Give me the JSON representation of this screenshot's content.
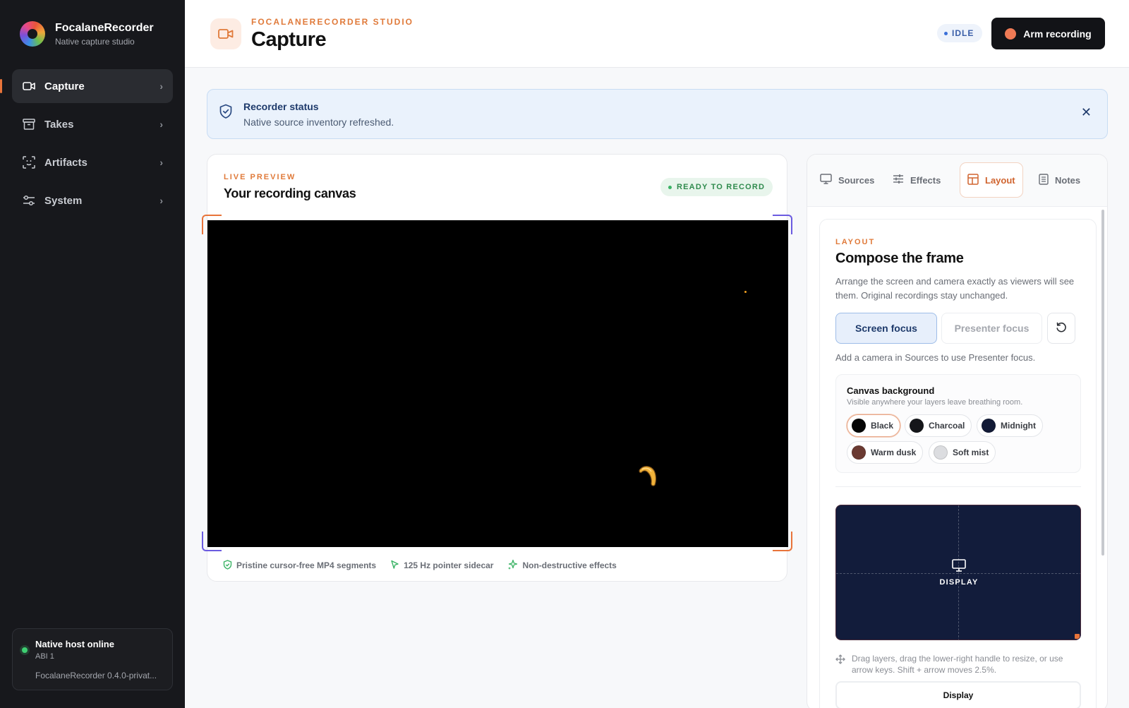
{
  "app": {
    "name": "FocalaneRecorder",
    "subtitle": "Native capture studio"
  },
  "sidebar": {
    "items": [
      {
        "label": "Capture",
        "icon": "video-camera-icon",
        "active": true
      },
      {
        "label": "Takes",
        "icon": "archive-box-icon",
        "active": false
      },
      {
        "label": "Artifacts",
        "icon": "scan-frame-icon",
        "active": false
      },
      {
        "label": "System",
        "icon": "sliders-icon",
        "active": false
      }
    ],
    "host": {
      "title": "Native host online",
      "abi": "ABI 1",
      "version": "FocalaneRecorder 0.4.0-privat..."
    }
  },
  "header": {
    "eyebrow": "FOCALANERECORDER STUDIO",
    "title": "Capture",
    "status": "IDLE",
    "arm_label": "Arm recording"
  },
  "banner": {
    "title": "Recorder status",
    "message": "Native source inventory refreshed.",
    "close_glyph": "✕"
  },
  "preview": {
    "eyebrow": "LIVE PREVIEW",
    "title": "Your recording canvas",
    "status": "READY TO RECORD",
    "features": [
      {
        "label": "Pristine cursor-free MP4 segments",
        "icon": "shield-check-icon"
      },
      {
        "label": "125 Hz pointer sidecar",
        "icon": "pointer-icon"
      },
      {
        "label": "Non-destructive effects",
        "icon": "sparkles-icon"
      }
    ]
  },
  "panel": {
    "tabs": [
      {
        "label": "Sources",
        "icon": "monitor-icon",
        "active": false
      },
      {
        "label": "Effects",
        "icon": "sliders-icon",
        "active": false
      },
      {
        "label": "Layout",
        "icon": "layout-icon",
        "active": true
      },
      {
        "label": "Notes",
        "icon": "notes-icon",
        "active": false
      }
    ],
    "layout": {
      "eyebrow": "LAYOUT",
      "title": "Compose the frame",
      "description": "Arrange the screen and camera exactly as viewers will see them. Original recordings stay unchanged.",
      "focus": {
        "screen": "Screen focus",
        "presenter": "Presenter focus",
        "hint": "Add a camera in Sources to use Presenter focus."
      },
      "background": {
        "title": "Canvas background",
        "subtitle": "Visible anywhere your layers leave breathing room.",
        "swatches": [
          {
            "label": "Black",
            "color": "#050505",
            "selected": true
          },
          {
            "label": "Charcoal",
            "color": "#15161a",
            "selected": false
          },
          {
            "label": "Midnight",
            "color": "#121a36",
            "selected": false
          },
          {
            "label": "Warm dusk",
            "color": "#6b3a32",
            "selected": false
          },
          {
            "label": "Soft mist",
            "color": "#dcdde0",
            "selected": false
          }
        ]
      },
      "frame": {
        "layer_label": "DISPLAY"
      },
      "drag_hint": "Drag layers, drag the lower-right handle to resize, or use arrow keys. Shift + arrow moves 2.5%.",
      "layer_button": "Display"
    }
  },
  "colors": {
    "accent": "#e07a3a",
    "sidebar_bg": "#17181c",
    "canvas_bg": "#000000",
    "frame_bg": "#121c3b"
  }
}
